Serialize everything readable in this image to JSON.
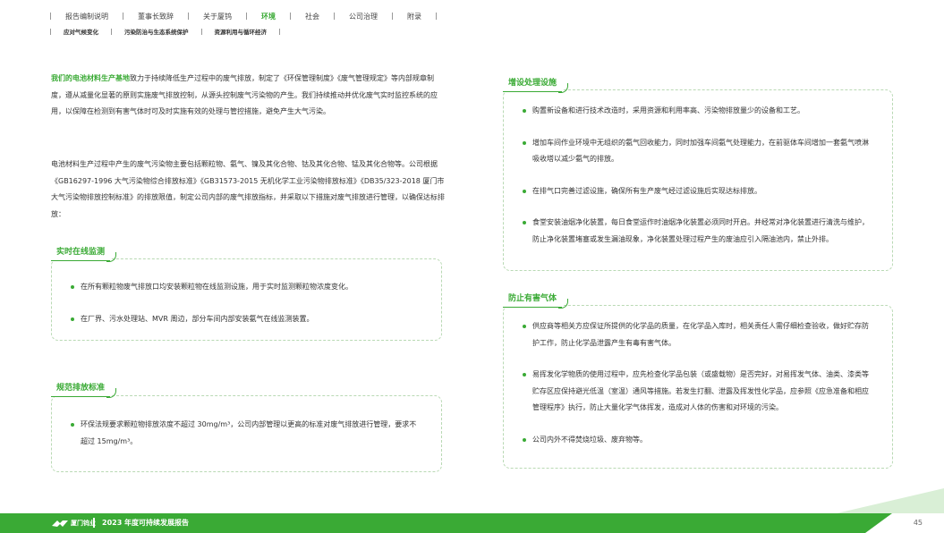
{
  "nav": {
    "items": [
      "报告编制说明",
      "董事长致辞",
      "关于厦钨",
      "环境",
      "社会",
      "公司治理",
      "附录"
    ],
    "active_index": 3,
    "sub_items": [
      "应对气候变化",
      "污染防治与生态系统保护",
      "资源利用与循环经济"
    ]
  },
  "intro": {
    "highlight": "我们的电池材料生产基地",
    "text1": "致力于持续降低生产过程中的废气排放，制定了《环保管理制度》《废气管理规定》等内部规章制度，遵从减量化显著的原则实施废气排放控制，从源头控制废气污染物的产生。我们持续推动并优化废气实时监控系统的应用，以保障在检测到有害气体时可及时实施有效的处理与管控措施，避免产生大气污染。",
    "text2": "电池材料生产过程中产生的废气污染物主要包括颗粒物、氨气、镍及其化合物、钴及其化合物、锰及其化合物等。公司根据《GB16297-1996 大气污染物综合排放标准》《GB31573-2015 无机化学工业污染物排放标准》《DB35/323-2018 厦门市大气污染物排放控制标准》的排放限值，制定公司内部的废气排放指标，并采取以下措施对废气排放进行管理，以确保达标排放："
  },
  "sections": {
    "monitor": {
      "title": "实时在线监测",
      "items": [
        "在所有颗粒物废气排放口均安装颗粒物在线监测设施，用于实时监测颗粒物浓度变化。",
        "在厂界、污水处理站、MVR 周边，部分车间内部安装氨气在线监测装置。"
      ]
    },
    "standard": {
      "title": "规范排放标准",
      "items": [
        "环保法规要求颗粒物排放浓度不超过 30mg/m³，公司内部管理以更高的标准对废气排放进行管理，要求不超过 15mg/m³。"
      ]
    },
    "facility": {
      "title": "增设处理设施",
      "items": [
        "购置新设备和进行技术改造时，采用资源和利用率高、污染物排放量少的设备和工艺。",
        "增加车间作业环境中无组织的氨气回收能力，同时加强车间氨气处理能力，在前驱体车间增加一套氨气喷淋吸收塔以减少氨气的排放。",
        "在排气口完善过滤设施，确保所有生产废气经过滤设施后实现达标排放。",
        "食堂安装油烟净化装置，每日食堂运作时油烟净化装置必须同时开启。并经常对净化装置进行清洗与维护，防止净化装置堵塞或发生漏油现象，净化装置处理过程产生的废油应引入隔油池内，禁止外排。"
      ]
    },
    "harmful": {
      "title": "防止有害气体",
      "items": [
        "供应商等相关方应保证所提供的化学品的质量，在化学品入库时，相关责任人需仔细检查验收，做好贮存防护工作，防止化学品泄露产生有毒有害气体。",
        "易挥发化学物质的使用过程中，应先检查化学品包装（或盛载物）是否完好，对易挥发气体、油类、漆类等贮存区应保持避光低温（室温）通风等措施。若发生打翻、泄露及挥发性化学品，应参照《应急准备和相应管理程序》执行，防止大量化学气体挥发，造成对人体的伤害和对环境的污染。",
        "公司内外不得焚烧垃圾、废弃物等。"
      ]
    }
  },
  "footer": {
    "brand": "厦门钨业",
    "title": "2023 年度可持续发展报告",
    "page": "45"
  },
  "colors": {
    "accent": "#3aaa35",
    "border": "#b9d9b4"
  }
}
